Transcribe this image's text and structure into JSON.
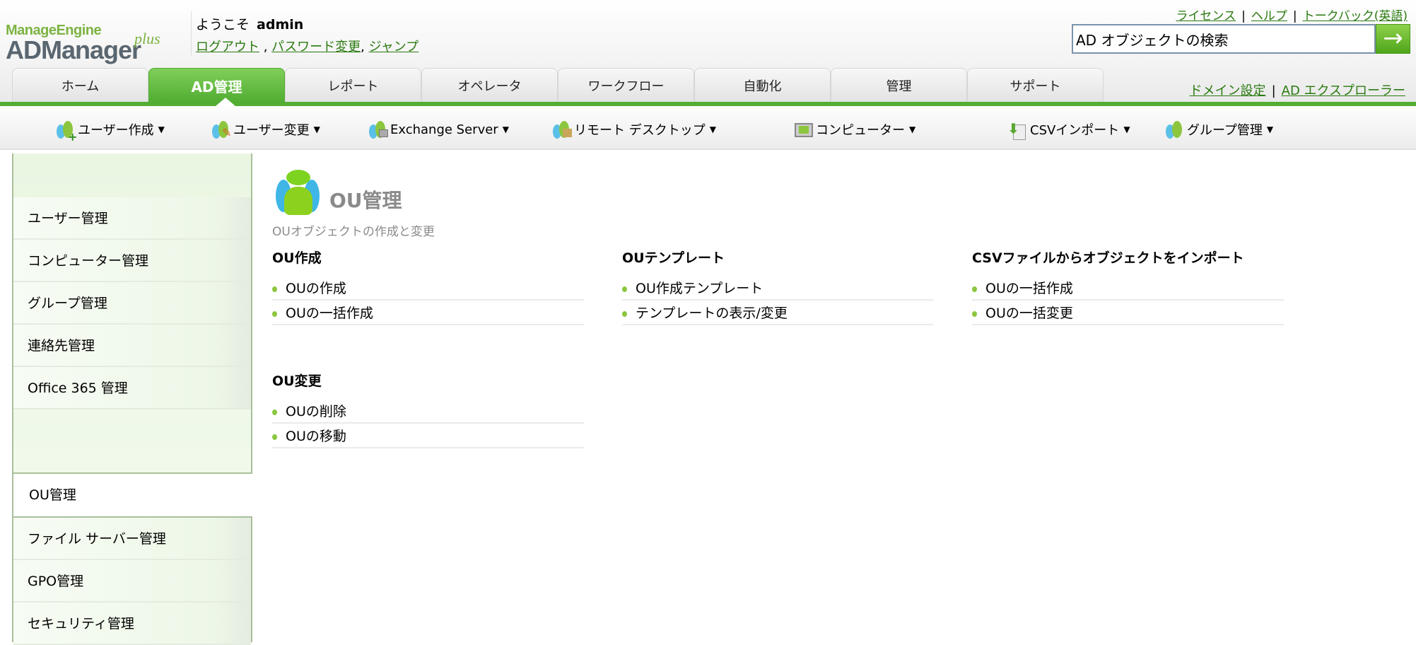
{
  "logo": {
    "company": "ManageEngine",
    "product": "ADManager",
    "suffix": "plus"
  },
  "header": {
    "welcome": "ようこそ",
    "user": "admin",
    "logout": "ログアウト",
    "sep1": " , ",
    "change_password": "パスワード変更",
    "sep2": ", ",
    "jump": "ジャンプ"
  },
  "top_links": {
    "license": "ライセンス",
    "help": "ヘルプ",
    "talkback": "トークバック(英語)",
    "sep": "|"
  },
  "search": {
    "value": "AD オブジェクトの検索",
    "button_icon": "→"
  },
  "tabs": [
    {
      "label": "ホーム"
    },
    {
      "label": "AD管理",
      "active": true
    },
    {
      "label": "レポート"
    },
    {
      "label": "オペレータ"
    },
    {
      "label": "ワークフロー"
    },
    {
      "label": "自動化"
    },
    {
      "label": "管理"
    },
    {
      "label": "サポート"
    }
  ],
  "domain_links": {
    "domain_settings": "ドメイン設定",
    "ad_explorer": "AD エクスプローラー",
    "sep": "|"
  },
  "toolbar": [
    {
      "label": "ユーザー作成"
    },
    {
      "label": "ユーザー変更"
    },
    {
      "label": "Exchange Server"
    },
    {
      "label": "リモート デスクトップ"
    },
    {
      "label": "コンピューター"
    },
    {
      "label": "CSVインポート"
    },
    {
      "label": "グループ管理"
    }
  ],
  "sidebar": {
    "items": [
      "ユーザー管理",
      "コンピューター管理",
      "グループ管理",
      "連絡先管理",
      "Office 365 管理"
    ],
    "selected": "OU管理",
    "items2": [
      "ファイル サーバー管理",
      "GPO管理",
      "セキュリティ管理"
    ]
  },
  "main": {
    "title": "OU管理",
    "subtitle": "OUオブジェクトの作成と変更",
    "sections": [
      {
        "heading": "OU作成",
        "links": [
          "OUの作成",
          "OUの一括作成"
        ]
      },
      {
        "heading": "OUテンプレート",
        "links": [
          "OU作成テンプレート",
          "テンプレートの表示/変更"
        ]
      },
      {
        "heading": "CSVファイルからオブジェクトをインポート",
        "links": [
          "OUの一括作成",
          "OUの一括変更"
        ]
      },
      {
        "heading": "OU変更",
        "links": [
          "OUの削除",
          "OUの移動"
        ]
      }
    ]
  },
  "colors": {
    "accent": "#52ad32",
    "link": "#2a7a10"
  }
}
